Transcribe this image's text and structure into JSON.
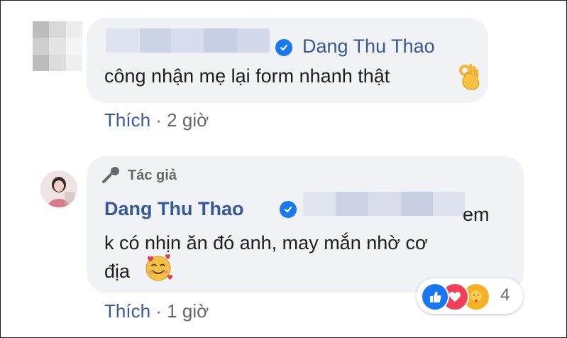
{
  "first_comment": {
    "tagged_name": "Dang Thu Thao",
    "text": "công nhận mẹ lại form nhanh thật",
    "emoji": "ok-hand-emoji",
    "meta": {
      "like": "Thích",
      "separator": "·",
      "time": "2 giờ"
    }
  },
  "reply": {
    "badge": "Tác giả",
    "author": "Dang Thu Thao",
    "text_line1": "em",
    "text_line2": "k có nhịn ăn đó anh, may mắn nhờ cơ",
    "text_line3": "địa",
    "emoji": "smiling-face-with-hearts-emoji",
    "meta": {
      "like": "Thích",
      "separator": "·",
      "time": "1 giờ"
    }
  },
  "reactions": {
    "types": [
      "like",
      "love",
      "care"
    ],
    "count": "4"
  },
  "colors": {
    "link": "#365899",
    "bubble": "#f0f2f5",
    "meta": "#65676b",
    "verified": "#1877f2"
  }
}
